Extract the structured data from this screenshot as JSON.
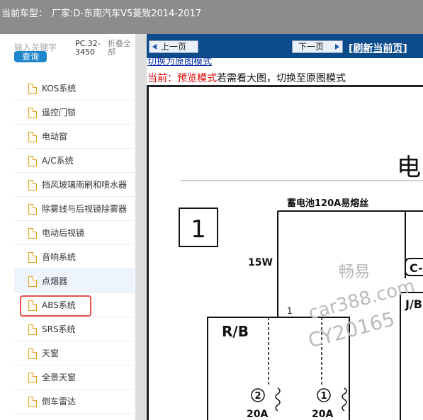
{
  "topbar": {
    "label": "当前车型：",
    "value": "厂家:D-东南汽车V5菱致2014-2017"
  },
  "left": {
    "search_placeholder": "输入关键字",
    "search_button": "查询",
    "page_ref": "PC.32-3450",
    "collapse_all": "折叠全部",
    "items": [
      {
        "label": "KOS系统"
      },
      {
        "label": "遥控门锁"
      },
      {
        "label": "电动窗"
      },
      {
        "label": "A/C系统"
      },
      {
        "label": "挡风玻璃雨刷和喷水器"
      },
      {
        "label": "除雾线与后视镜除雾器"
      },
      {
        "label": "电动后视镜"
      },
      {
        "label": "音响系统"
      },
      {
        "label": "点烟器"
      },
      {
        "label": "ABS系统"
      },
      {
        "label": "SRS系统"
      },
      {
        "label": "天窗"
      },
      {
        "label": "全景天窗"
      },
      {
        "label": "倒车雷达"
      }
    ]
  },
  "viewer": {
    "prev_label": "上一页",
    "next_label": "下一页",
    "refresh_label": "[刷新当前页]",
    "switch_link": "切换为原图模式",
    "mode_prefix": "当前：",
    "mode_name": "预览模式",
    "mode_hint": "若需看大图，切换至原图模式"
  },
  "diagram": {
    "title": "电",
    "box_number": "1",
    "battery_fuse": "蓄电池120A易熔丝",
    "fuse_15w": "15W",
    "connector_c": "C-",
    "connector_jb": "J/B",
    "wire_number": "1",
    "rb_label": "R/B",
    "fuse1_number": "2",
    "fuse1_rating": "20A",
    "fuse2_number": "1",
    "fuse2_rating": "20A",
    "watermark1": "畅易",
    "watermark2": "car388.com",
    "watermark3": "CY20165"
  }
}
